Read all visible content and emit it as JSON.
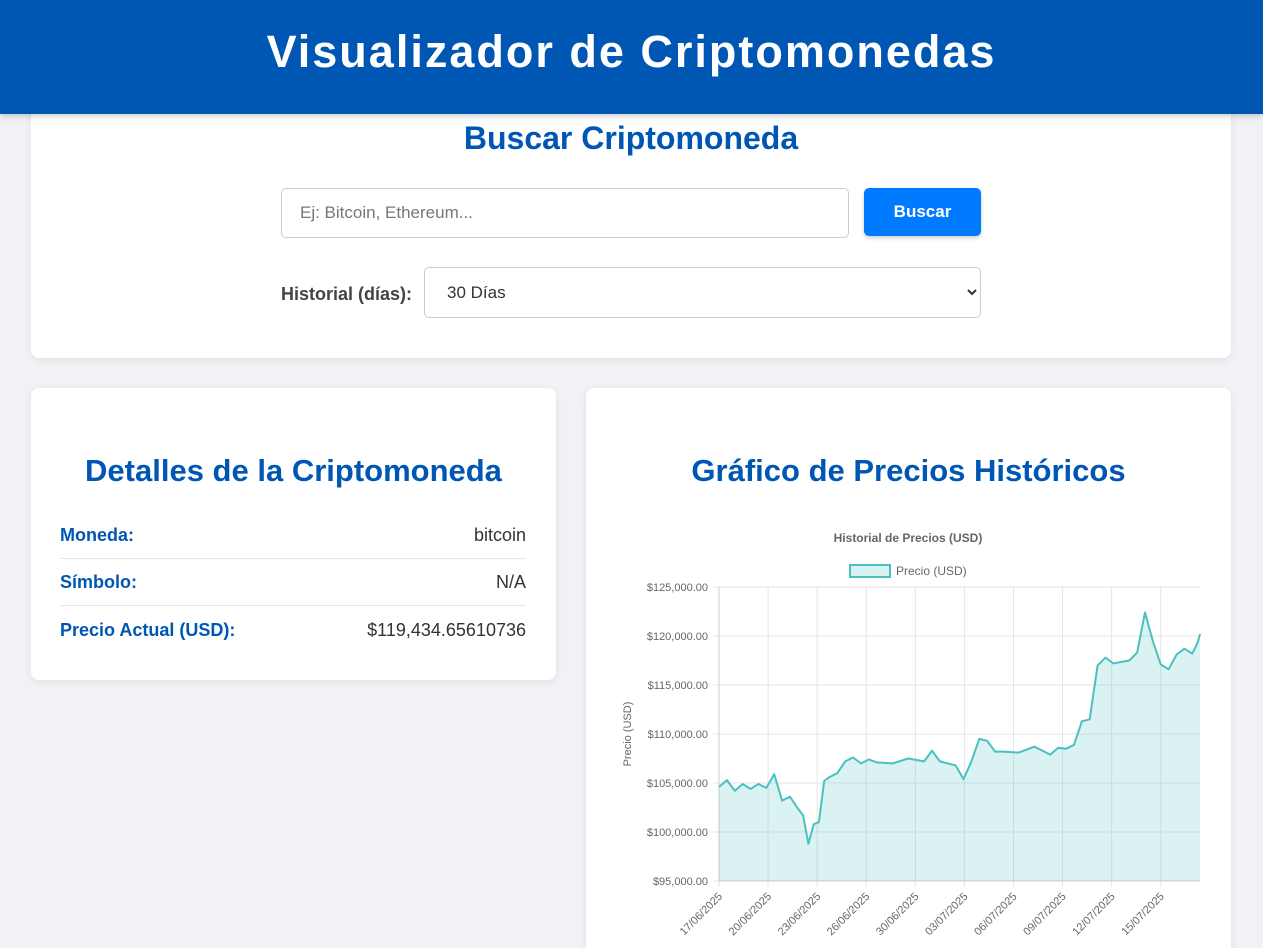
{
  "header": {
    "title": "Visualizador de Criptomonedas"
  },
  "search": {
    "heading": "Buscar Criptomoneda",
    "placeholder": "Ej: Bitcoin, Ethereum...",
    "value": "",
    "button_label": "Buscar",
    "history_label": "Historial (días):",
    "history_selected": "30 Días"
  },
  "details": {
    "heading": "Detalles de la Criptomoneda",
    "rows": [
      {
        "key": "Moneda:",
        "value": "bitcoin"
      },
      {
        "key": "Símbolo:",
        "value": "N/A"
      },
      {
        "key": "Precio Actual (USD):",
        "value": "$119,434.65610736"
      }
    ]
  },
  "chart": {
    "heading": "Gráfico de Precios Históricos"
  },
  "colors": {
    "brand": "#0056b3",
    "button": "#007bff",
    "line": "#4bc0c0",
    "fill": "rgba(75,192,192,0.2)"
  },
  "chart_data": {
    "type": "area",
    "title": "Historial de Precios (USD)",
    "legend": "top",
    "series": [
      {
        "name": "Precio (USD)"
      }
    ],
    "ylabel": "Precio (USD)",
    "xlabel": "",
    "ylim": [
      95000,
      125000
    ],
    "grid": true,
    "y_ticks": [
      "$95,000.00",
      "$100,000.00",
      "$105,000.00",
      "$110,000.00",
      "$115,000.00",
      "$120,000.00",
      "$125,000.00"
    ],
    "x_ticks": [
      "17/06/2025",
      "20/06/2025",
      "23/06/2025",
      "26/06/2025",
      "30/06/2025",
      "03/07/2025",
      "06/07/2025",
      "09/07/2025",
      "12/07/2025",
      "15/07/2025"
    ],
    "points": [
      [
        "2025-06-17",
        104600
      ],
      [
        "2025-06-17",
        105300
      ],
      [
        "2025-06-18",
        104200
      ],
      [
        "2025-06-18",
        104900
      ],
      [
        "2025-06-19",
        104400
      ],
      [
        "2025-06-19",
        104900
      ],
      [
        "2025-06-20",
        104500
      ],
      [
        "2025-06-20",
        105900
      ],
      [
        "2025-06-21",
        103200
      ],
      [
        "2025-06-21",
        103600
      ],
      [
        "2025-06-22",
        102400
      ],
      [
        "2025-06-22",
        101700
      ],
      [
        "2025-06-22",
        98800
      ],
      [
        "2025-06-23",
        100800
      ],
      [
        "2025-06-23",
        101000
      ],
      [
        "2025-06-23",
        105200
      ],
      [
        "2025-06-24",
        105600
      ],
      [
        "2025-06-24",
        106000
      ],
      [
        "2025-06-25",
        107200
      ],
      [
        "2025-06-25",
        107600
      ],
      [
        "2025-06-26",
        107000
      ],
      [
        "2025-06-26",
        107400
      ],
      [
        "2025-06-27",
        107100
      ],
      [
        "2025-06-28",
        107000
      ],
      [
        "2025-06-29",
        107500
      ],
      [
        "2025-06-30",
        107200
      ],
      [
        "2025-06-30",
        108300
      ],
      [
        "2025-07-01",
        107200
      ],
      [
        "2025-07-02",
        106800
      ],
      [
        "2025-07-02",
        105400
      ],
      [
        "2025-07-03",
        107200
      ],
      [
        "2025-07-03",
        109500
      ],
      [
        "2025-07-04",
        109300
      ],
      [
        "2025-07-04",
        108200
      ],
      [
        "2025-07-05",
        108200
      ],
      [
        "2025-07-06",
        108100
      ],
      [
        "2025-07-07",
        108700
      ],
      [
        "2025-07-08",
        107900
      ],
      [
        "2025-07-08",
        108600
      ],
      [
        "2025-07-09",
        108500
      ],
      [
        "2025-07-09",
        108900
      ],
      [
        "2025-07-10",
        111300
      ],
      [
        "2025-07-10",
        111500
      ],
      [
        "2025-07-11",
        117000
      ],
      [
        "2025-07-11",
        117800
      ],
      [
        "2025-07-12",
        117200
      ],
      [
        "2025-07-13",
        117500
      ],
      [
        "2025-07-13",
        118300
      ],
      [
        "2025-07-14",
        122400
      ],
      [
        "2025-07-14",
        119500
      ],
      [
        "2025-07-15",
        117100
      ],
      [
        "2025-07-15",
        116600
      ],
      [
        "2025-07-16",
        118100
      ],
      [
        "2025-07-16",
        118700
      ],
      [
        "2025-07-17",
        118200
      ],
      [
        "2025-07-17",
        119300
      ],
      [
        "2025-07-17",
        120200
      ]
    ]
  }
}
